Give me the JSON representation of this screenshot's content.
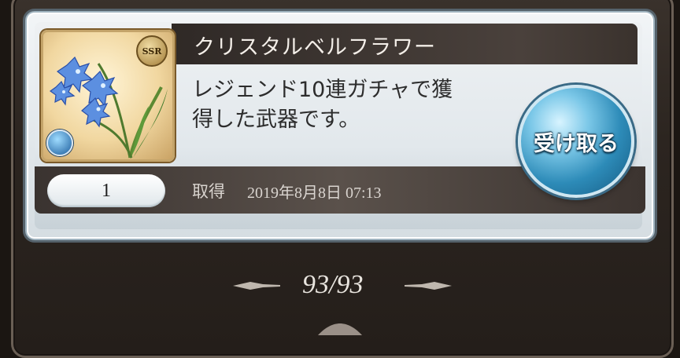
{
  "item": {
    "name": "クリスタルベルフラワー",
    "description_line1": "レジェンド10連ガチャで獲",
    "description_line2": "得した武器です。",
    "rarity": "SSR",
    "element_icon": "water-element-icon",
    "quantity": "1",
    "obtained_label": "取得",
    "obtained_date": "2019年8月8日 07:13"
  },
  "receive_button": {
    "label": "受け取る"
  },
  "pager": {
    "text": "93/93"
  },
  "colors": {
    "title_bar": "#3a322d",
    "button": "#2d8bb8",
    "card": "#e2e8ec"
  }
}
